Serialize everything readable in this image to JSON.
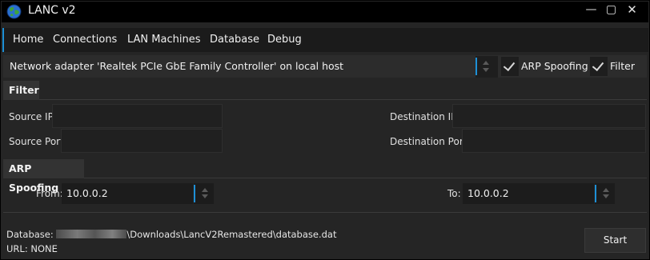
{
  "window": {
    "title": "LANC v2",
    "minimize_glyph": "—",
    "maximize_glyph": "▢",
    "close_glyph": "✕"
  },
  "tabs": [
    "Home",
    "Connections",
    "LAN Machines",
    "Database",
    "Debug"
  ],
  "active_tab": "Home",
  "adapter": {
    "text": "Network adapter 'Realtek PCIe GbE Family Controller' on local host",
    "arp_spoofing_label": "ARP Spoofing",
    "arp_spoofing_checked": true,
    "filter_label": "Filter",
    "filter_checked": true
  },
  "filter": {
    "header": "Filter",
    "source_ip_label": "Source IP:",
    "source_ip_value": "",
    "source_port_label": "Source Port:",
    "source_port_value": "",
    "destination_ip_label": "Destination IP:",
    "destination_ip_value": "",
    "destination_port_label": "Destination Port:",
    "destination_port_value": ""
  },
  "arp_spoofing": {
    "header": "ARP Spoofing",
    "from_label": "From:",
    "from_value": "10.0.0.2",
    "to_label": "To:",
    "to_value": "10.0.0.2"
  },
  "status": {
    "database_prefix": "Database: ",
    "database_path": "\\Downloads\\LancV2Remastered\\database.dat",
    "url": "URL: NONE"
  },
  "start_label": "Start",
  "colors": {
    "accent": "#1e90d6",
    "background": "#252525",
    "titlebar": "#000000"
  }
}
